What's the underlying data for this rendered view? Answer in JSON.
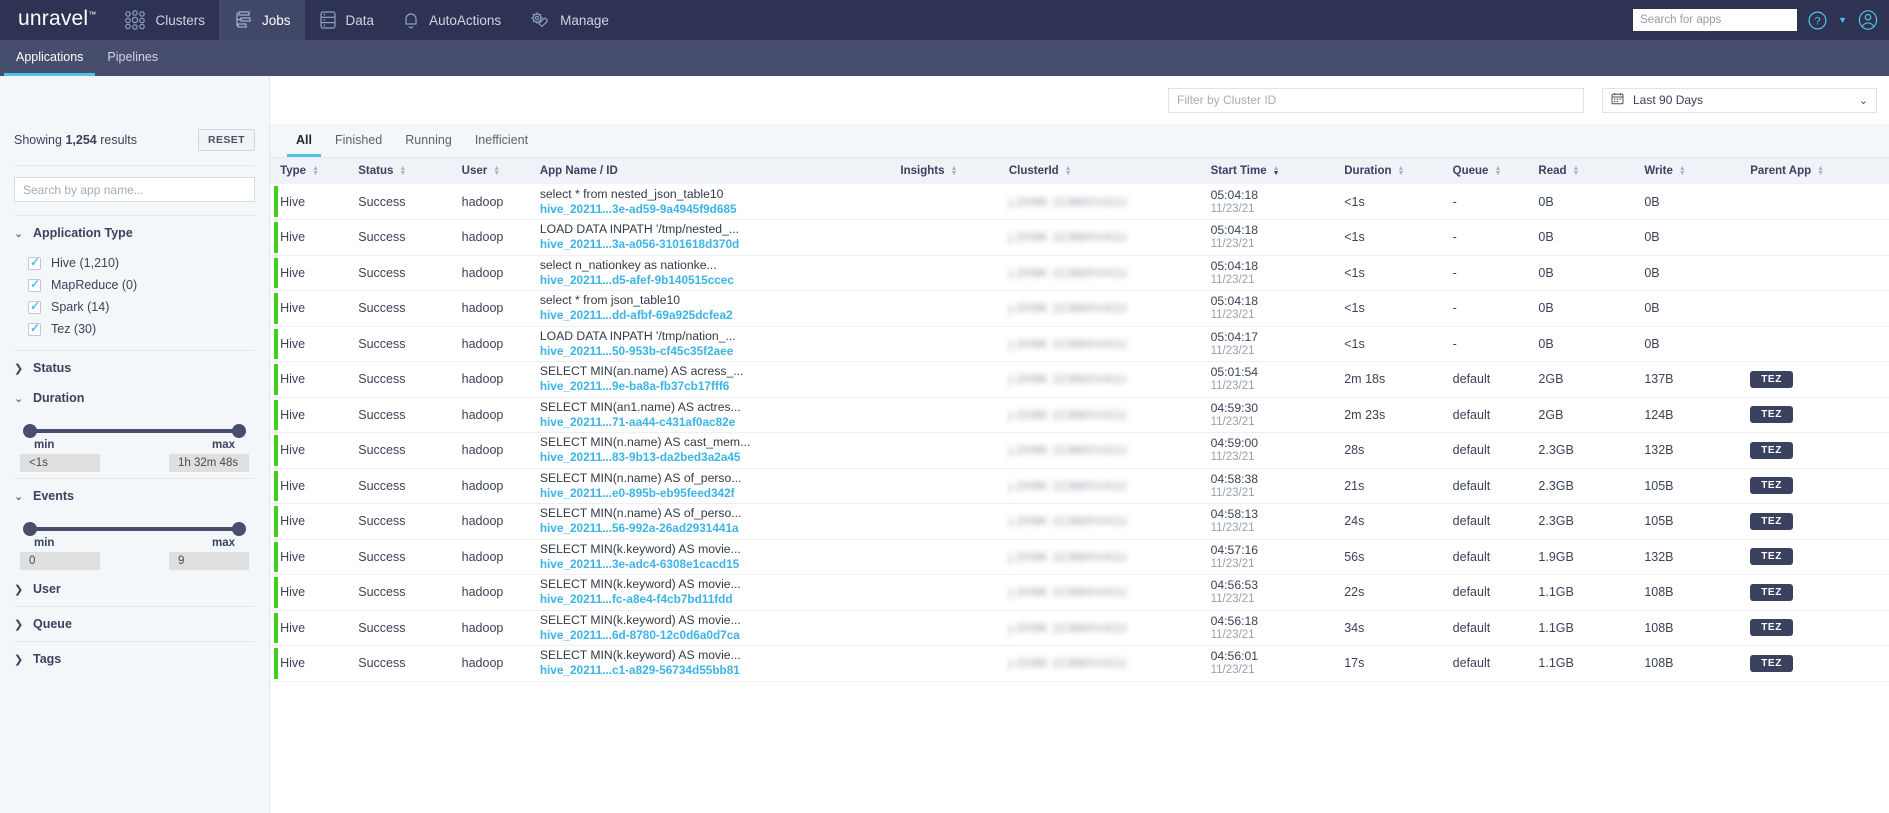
{
  "brand": {
    "name": "unravel",
    "tm": "™"
  },
  "topnav": {
    "items": [
      {
        "label": "Clusters",
        "icon": "clusters-icon",
        "active": false
      },
      {
        "label": "Jobs",
        "icon": "jobs-icon",
        "active": true
      },
      {
        "label": "Data",
        "icon": "data-icon",
        "active": false
      },
      {
        "label": "AutoActions",
        "icon": "bell-icon",
        "active": false
      },
      {
        "label": "Manage",
        "icon": "gear-wrench-icon",
        "active": false
      }
    ],
    "search_placeholder": "Search for apps",
    "search_value": "",
    "help_icon": "help-circle-icon",
    "account_icon": "user-avatar-icon"
  },
  "subnav": {
    "tabs": [
      {
        "label": "Applications",
        "active": true
      },
      {
        "label": "Pipelines",
        "active": false
      }
    ]
  },
  "sidebar": {
    "showing_prefix": "Showing",
    "showing_count": "1,254",
    "showing_suffix": "results",
    "reset_label": "RESET",
    "search_placeholder": "Search by app name...",
    "search_value": "",
    "facets": [
      {
        "title": "Application Type",
        "expanded": true,
        "options": [
          {
            "label": "Hive (1,210)",
            "checked": true
          },
          {
            "label": "MapReduce (0)",
            "checked": true
          },
          {
            "label": "Spark (14)",
            "checked": true
          },
          {
            "label": "Tez (30)",
            "checked": true
          }
        ]
      },
      {
        "title": "Status",
        "expanded": false
      },
      {
        "title": "Duration",
        "expanded": true,
        "min_label": "min",
        "max_label": "max",
        "min_value": "<1s",
        "max_value": "1h 32m 48s"
      },
      {
        "title": "Events",
        "expanded": true,
        "min_label": "min",
        "max_label": "max",
        "min_value": "0",
        "max_value": "9"
      },
      {
        "title": "User",
        "expanded": false
      },
      {
        "title": "Queue",
        "expanded": false
      },
      {
        "title": "Tags",
        "expanded": false
      }
    ]
  },
  "filterbar": {
    "cluster_placeholder": "Filter by Cluster ID",
    "cluster_value": "",
    "daterange_label": "Last 90 Days",
    "calendar_icon": "calendar-icon",
    "chevron_icon": "chevron-down-icon"
  },
  "tabs": [
    {
      "label": "All",
      "active": true
    },
    {
      "label": "Finished",
      "active": false
    },
    {
      "label": "Running",
      "active": false
    },
    {
      "label": "Inefficient",
      "active": false
    }
  ],
  "table": {
    "columns": [
      {
        "label": "Type",
        "sortable": true,
        "sorted": "none"
      },
      {
        "label": "Status",
        "sortable": true,
        "sorted": "none"
      },
      {
        "label": "User",
        "sortable": true,
        "sorted": "none"
      },
      {
        "label": "App Name / ID",
        "sortable": false,
        "sorted": "none"
      },
      {
        "label": "Insights",
        "sortable": true,
        "sorted": "none"
      },
      {
        "label": "ClusterId",
        "sortable": true,
        "sorted": "none"
      },
      {
        "label": "Start Time",
        "sortable": true,
        "sorted": "desc"
      },
      {
        "label": "Duration",
        "sortable": true,
        "sorted": "none"
      },
      {
        "label": "Queue",
        "sortable": true,
        "sorted": "none"
      },
      {
        "label": "Read",
        "sortable": true,
        "sorted": "none"
      },
      {
        "label": "Write",
        "sortable": true,
        "sorted": "none"
      },
      {
        "label": "Parent App",
        "sortable": true,
        "sorted": "none"
      }
    ],
    "rows": [
      {
        "type": "Hive",
        "status": "Success",
        "user": "hadoop",
        "app_name": "select * from nested_json_table10",
        "app_id": "hive_20211...3e-ad59-9a4945f9d685",
        "insights": "",
        "cluster_id": "redacted",
        "start_time": "05:04:18",
        "start_date": "11/23/21",
        "duration": "<1s",
        "queue": "-",
        "read": "0B",
        "write": "0B",
        "parent_app": ""
      },
      {
        "type": "Hive",
        "status": "Success",
        "user": "hadoop",
        "app_name": "LOAD DATA INPATH '/tmp/nested_...",
        "app_id": "hive_20211...3a-a056-3101618d370d",
        "insights": "",
        "cluster_id": "redacted",
        "start_time": "05:04:18",
        "start_date": "11/23/21",
        "duration": "<1s",
        "queue": "-",
        "read": "0B",
        "write": "0B",
        "parent_app": ""
      },
      {
        "type": "Hive",
        "status": "Success",
        "user": "hadoop",
        "app_name": "select n_nationkey as nationke...",
        "app_id": "hive_20211...d5-afef-9b140515ccec",
        "insights": "",
        "cluster_id": "redacted",
        "start_time": "05:04:18",
        "start_date": "11/23/21",
        "duration": "<1s",
        "queue": "-",
        "read": "0B",
        "write": "0B",
        "parent_app": ""
      },
      {
        "type": "Hive",
        "status": "Success",
        "user": "hadoop",
        "app_name": "select * from json_table10",
        "app_id": "hive_20211...dd-afbf-69a925dcfea2",
        "insights": "",
        "cluster_id": "redacted",
        "start_time": "05:04:18",
        "start_date": "11/23/21",
        "duration": "<1s",
        "queue": "-",
        "read": "0B",
        "write": "0B",
        "parent_app": ""
      },
      {
        "type": "Hive",
        "status": "Success",
        "user": "hadoop",
        "app_name": "LOAD DATA INPATH '/tmp/nation_...",
        "app_id": "hive_20211...50-953b-cf45c35f2aee",
        "insights": "",
        "cluster_id": "redacted",
        "start_time": "05:04:17",
        "start_date": "11/23/21",
        "duration": "<1s",
        "queue": "-",
        "read": "0B",
        "write": "0B",
        "parent_app": ""
      },
      {
        "type": "Hive",
        "status": "Success",
        "user": "hadoop",
        "app_name": "SELECT MIN(an.name) AS acress_...",
        "app_id": "hive_20211...9e-ba8a-fb37cb17fff6",
        "insights": "",
        "cluster_id": "redacted",
        "start_time": "05:01:54",
        "start_date": "11/23/21",
        "duration": "2m 18s",
        "queue": "default",
        "read": "2GB",
        "write": "137B",
        "parent_app": "TEZ"
      },
      {
        "type": "Hive",
        "status": "Success",
        "user": "hadoop",
        "app_name": "SELECT MIN(an1.name) AS actres...",
        "app_id": "hive_20211...71-aa44-c431af0ac82e",
        "insights": "",
        "cluster_id": "redacted",
        "start_time": "04:59:30",
        "start_date": "11/23/21",
        "duration": "2m 23s",
        "queue": "default",
        "read": "2GB",
        "write": "124B",
        "parent_app": "TEZ"
      },
      {
        "type": "Hive",
        "status": "Success",
        "user": "hadoop",
        "app_name": "SELECT MIN(n.name) AS cast_mem...",
        "app_id": "hive_20211...83-9b13-da2bed3a2a45",
        "insights": "",
        "cluster_id": "redacted",
        "start_time": "04:59:00",
        "start_date": "11/23/21",
        "duration": "28s",
        "queue": "default",
        "read": "2.3GB",
        "write": "132B",
        "parent_app": "TEZ"
      },
      {
        "type": "Hive",
        "status": "Success",
        "user": "hadoop",
        "app_name": "SELECT MIN(n.name) AS of_perso...",
        "app_id": "hive_20211...e0-895b-eb95feed342f",
        "insights": "",
        "cluster_id": "redacted",
        "start_time": "04:58:38",
        "start_date": "11/23/21",
        "duration": "21s",
        "queue": "default",
        "read": "2.3GB",
        "write": "105B",
        "parent_app": "TEZ"
      },
      {
        "type": "Hive",
        "status": "Success",
        "user": "hadoop",
        "app_name": "SELECT MIN(n.name) AS of_perso...",
        "app_id": "hive_20211...56-992a-26ad2931441a",
        "insights": "",
        "cluster_id": "redacted",
        "start_time": "04:58:13",
        "start_date": "11/23/21",
        "duration": "24s",
        "queue": "default",
        "read": "2.3GB",
        "write": "105B",
        "parent_app": "TEZ"
      },
      {
        "type": "Hive",
        "status": "Success",
        "user": "hadoop",
        "app_name": "SELECT MIN(k.keyword) AS movie...",
        "app_id": "hive_20211...3e-adc4-6308e1cacd15",
        "insights": "",
        "cluster_id": "redacted",
        "start_time": "04:57:16",
        "start_date": "11/23/21",
        "duration": "56s",
        "queue": "default",
        "read": "1.9GB",
        "write": "132B",
        "parent_app": "TEZ"
      },
      {
        "type": "Hive",
        "status": "Success",
        "user": "hadoop",
        "app_name": "SELECT MIN(k.keyword) AS movie...",
        "app_id": "hive_20211...fc-a8e4-f4cb7bd11fdd",
        "insights": "",
        "cluster_id": "redacted",
        "start_time": "04:56:53",
        "start_date": "11/23/21",
        "duration": "22s",
        "queue": "default",
        "read": "1.1GB",
        "write": "108B",
        "parent_app": "TEZ"
      },
      {
        "type": "Hive",
        "status": "Success",
        "user": "hadoop",
        "app_name": "SELECT MIN(k.keyword) AS movie...",
        "app_id": "hive_20211...6d-8780-12c0d6a0d7ca",
        "insights": "",
        "cluster_id": "redacted",
        "start_time": "04:56:18",
        "start_date": "11/23/21",
        "duration": "34s",
        "queue": "default",
        "read": "1.1GB",
        "write": "108B",
        "parent_app": "TEZ"
      },
      {
        "type": "Hive",
        "status": "Success",
        "user": "hadoop",
        "app_name": "SELECT MIN(k.keyword) AS movie...",
        "app_id": "hive_20211...c1-a829-56734d55bb81",
        "insights": "",
        "cluster_id": "redacted",
        "start_time": "04:56:01",
        "start_date": "11/23/21",
        "duration": "17s",
        "queue": "default",
        "read": "1.1GB",
        "write": "108B",
        "parent_app": "TEZ"
      }
    ]
  },
  "colors": {
    "nav_bg": "#2e3353",
    "subnav_bg": "#474d6d",
    "accent": "#4fc3e8",
    "link": "#3cb4e5",
    "status_bar": "#3fd01e",
    "sidebar_bg": "#f4f7f9"
  }
}
